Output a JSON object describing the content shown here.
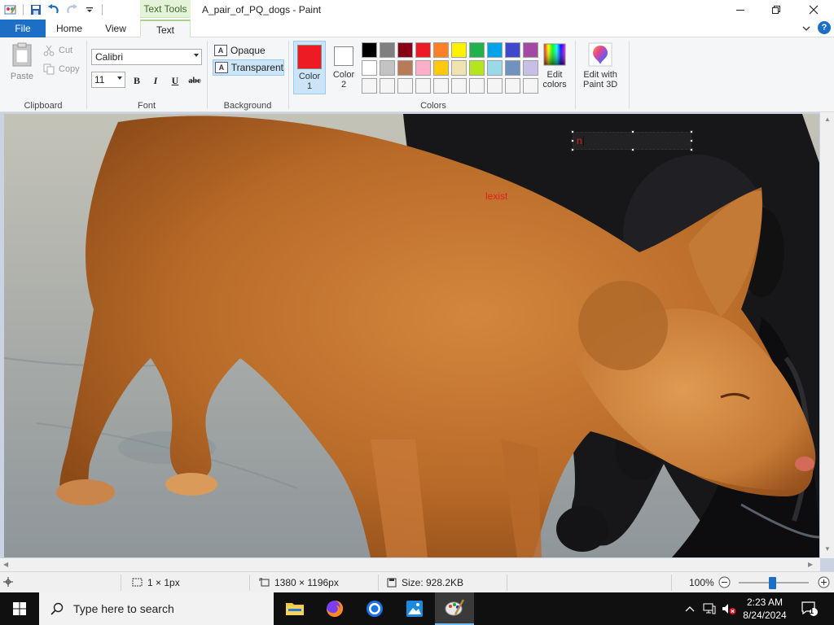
{
  "window": {
    "title": "A_pair_of_PQ_dogs - Paint",
    "context_tab": "Text Tools"
  },
  "tabs": {
    "file": "File",
    "home": "Home",
    "view": "View",
    "text": "Text"
  },
  "help_label": "?",
  "clipboard": {
    "paste": "Paste",
    "cut": "Cut",
    "copy": "Copy",
    "group": "Clipboard"
  },
  "font": {
    "family": "Calibri",
    "size": "11",
    "bold": "B",
    "italic": "I",
    "underline": "U",
    "strike": "abc",
    "group": "Font"
  },
  "background": {
    "opaque": "Opaque",
    "transparent": "Transparent",
    "group": "Background",
    "icon_letter": "A"
  },
  "colors": {
    "color1_line1": "Color",
    "color1_line2": "1",
    "color2_line1": "Color",
    "color2_line2": "2",
    "color1_value": "#ed1c24",
    "color2_value": "#ffffff",
    "edit_line1": "Edit",
    "edit_line2": "colors",
    "group": "Colors",
    "palette": [
      "#000000",
      "#7f7f7f",
      "#880015",
      "#ed1c24",
      "#ff7f27",
      "#fff200",
      "#22b14c",
      "#00a2e8",
      "#3f48cc",
      "#a349a4",
      "#ffffff",
      "#c3c3c3",
      "#b97a57",
      "#ffaec9",
      "#ffc90e",
      "#efe4b0",
      "#b5e61d",
      "#99d9ea",
      "#7092be",
      "#c8bfe7",
      "#f5f5f5",
      "#f5f5f5",
      "#f5f5f5",
      "#f5f5f5",
      "#f5f5f5",
      "#f5f5f5",
      "#f5f5f5",
      "#f5f5f5",
      "#f5f5f5",
      "#f5f5f5"
    ]
  },
  "paint3d": {
    "line1": "Edit with",
    "line2": "Paint 3D"
  },
  "canvas": {
    "textbox_value": "n",
    "painted_text": "lexist"
  },
  "status": {
    "selection": "1 × 1px",
    "dimensions": "1380 × 1196px",
    "size": "Size: 928.2KB",
    "zoom": "100%",
    "zoom_fraction": 0.48
  },
  "taskbar": {
    "search_placeholder": "Type here to search",
    "time": "2:23 AM",
    "date": "8/24/2024",
    "notification_count": "1"
  }
}
